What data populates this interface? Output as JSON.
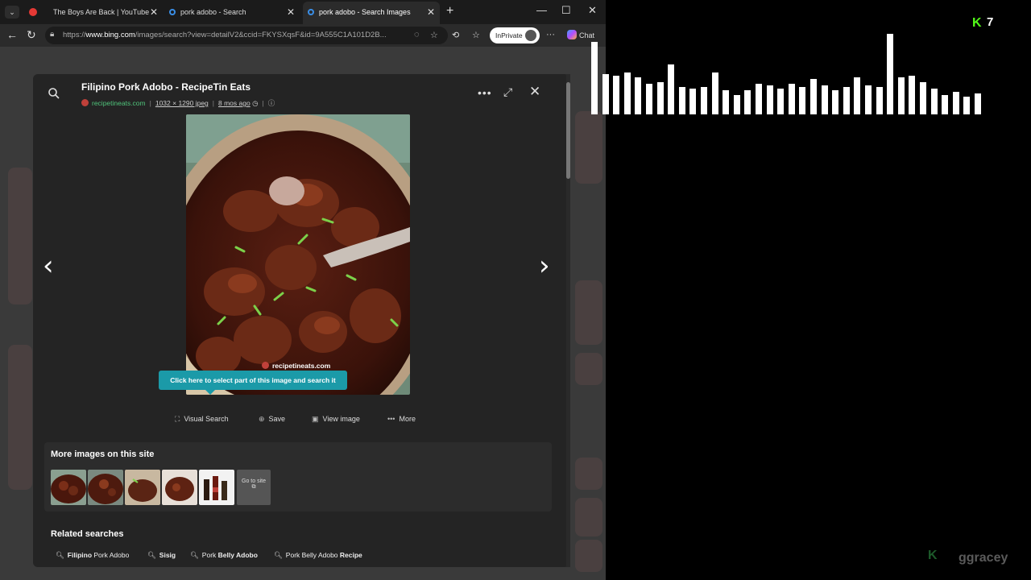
{
  "tabs": [
    {
      "label": "The Boys Are Back | YouTube",
      "active": false,
      "favicon_color": "#e53935"
    },
    {
      "label": "pork adobo - Search",
      "active": false,
      "favicon_color": "#3a8ee6"
    },
    {
      "label": "pork adobo - Search Images",
      "active": true,
      "favicon_color": "#3a8ee6"
    }
  ],
  "address_bar": {
    "url_prefix": "https://",
    "url_domain": "www.bing.com",
    "url_rest": "/images/search?view=detailV2&ccid=FKYSXqsF&id=9A555C1A101D2B...",
    "inprivate_label": "InPrivate",
    "chat_label": "Chat"
  },
  "detail": {
    "title": "Filipino Pork Adobo - RecipeTin Eats",
    "site": "recipetineats.com",
    "dimensions": "1032 × 1290 jpeg",
    "age": "8 mos ago",
    "tooltip": "Click here to select part of this image and search it",
    "watermark": "recipetineats.com",
    "actions": {
      "visual_search": "Visual Search",
      "save": "Save",
      "view_image": "View image",
      "more": "More"
    },
    "more_images_title": "More images on this site",
    "goto_site": "Go to site",
    "related_title": "Related searches",
    "related": [
      {
        "bold": "Filipino",
        "rest": " Pork Adobo"
      },
      {
        "bold": "Sisig",
        "rest": ""
      },
      {
        "pre": "Pork ",
        "bold": "Belly Adobo"
      },
      {
        "pre": "Pork Belly Adobo ",
        "bold": "Recipe"
      }
    ]
  },
  "overlay": {
    "kick_count": "7",
    "streamer": "ggracey",
    "accent": "#53fc18"
  },
  "icons": [
    "search-icon",
    "more-icon",
    "expand-icon",
    "close-icon",
    "prev-arrow-icon",
    "next-arrow-icon",
    "visual-search-icon",
    "save-icon",
    "view-image-icon"
  ]
}
